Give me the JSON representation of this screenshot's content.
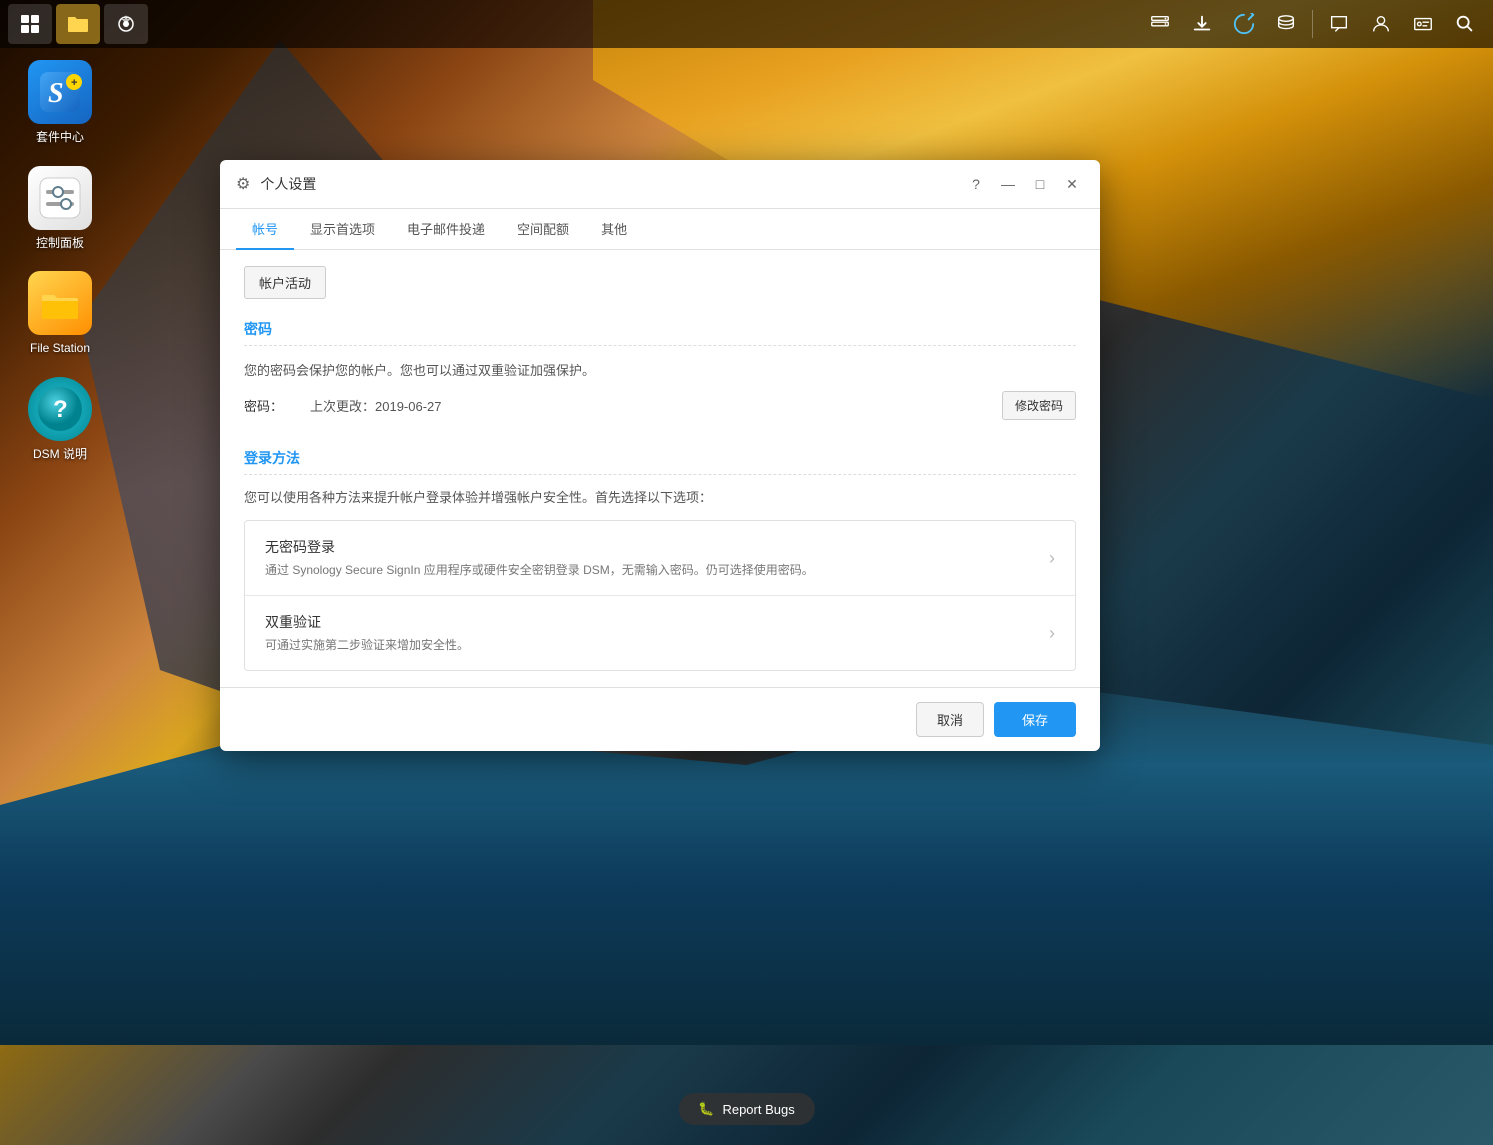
{
  "desktop": {
    "icons": [
      {
        "id": "package-center",
        "label": "套件中心",
        "type": "pkg"
      },
      {
        "id": "control-panel",
        "label": "控制面板",
        "type": "ctrl"
      },
      {
        "id": "file-station",
        "label": "File Station",
        "type": "file"
      },
      {
        "id": "dsm-help",
        "label": "DSM 说明",
        "type": "dsm"
      }
    ]
  },
  "taskbar": {
    "left_buttons": [
      {
        "id": "apps-grid",
        "icon": "⊞"
      },
      {
        "id": "folder-btn",
        "icon": "📁"
      },
      {
        "id": "settings-btn",
        "icon": "⚙"
      }
    ],
    "right_icons": [
      {
        "id": "upload-icon",
        "icon": "⬆"
      },
      {
        "id": "download-icon",
        "icon": "⬇"
      },
      {
        "id": "sync-icon",
        "icon": "🔄"
      },
      {
        "id": "stack-icon",
        "icon": "▤"
      },
      {
        "id": "chat-icon",
        "icon": "💬"
      },
      {
        "id": "user-icon",
        "icon": "👤"
      },
      {
        "id": "id-icon",
        "icon": "🪪"
      },
      {
        "id": "search-icon",
        "icon": "🔍"
      }
    ]
  },
  "dialog": {
    "title": "个人设置",
    "tabs": [
      {
        "id": "account",
        "label": "帐号",
        "active": true
      },
      {
        "id": "display",
        "label": "显示首选项",
        "active": false
      },
      {
        "id": "email",
        "label": "电子邮件投递",
        "active": false
      },
      {
        "id": "quota",
        "label": "空间配额",
        "active": false
      },
      {
        "id": "other",
        "label": "其他",
        "active": false
      }
    ],
    "account_activity_btn": "帐户活动",
    "password_section": {
      "title": "密码",
      "description": "您的密码会保护您的帐户。您也可以通过双重验证加强保护。",
      "label": "密码：",
      "last_changed": "上次更改：2019-06-27",
      "change_btn": "修改密码"
    },
    "login_section": {
      "title": "登录方法",
      "description": "您可以使用各种方法来提升帐户登录体验并增强帐户安全性。首先选择以下选项：",
      "cards": [
        {
          "id": "passwordless",
          "title": "无密码登录",
          "description": "通过 Synology Secure SignIn 应用程序或硬件安全密钥登录 DSM，无需输入密码。仍可选择使用密码。"
        },
        {
          "id": "two-factor",
          "title": "双重验证",
          "description": "可通过实施第二步验证来增加安全性。"
        }
      ]
    },
    "footer": {
      "cancel_btn": "取消",
      "save_btn": "保存"
    }
  },
  "report_bugs": {
    "label": "Report Bugs",
    "icon": "🐛"
  }
}
